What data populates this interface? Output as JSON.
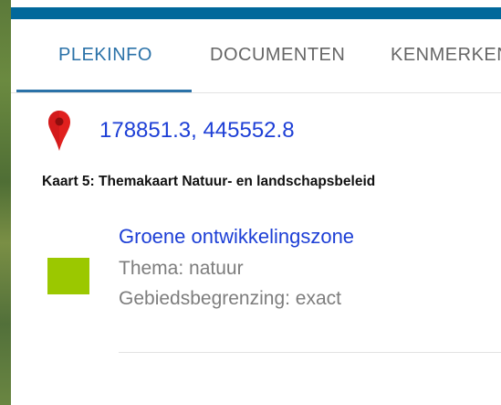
{
  "colors": {
    "top_bar": "#01689b",
    "active_tab": "#2b72a8",
    "link": "#1d3fd6",
    "pin": "#e0201e",
    "swatch": "#9bc800"
  },
  "tabs": [
    {
      "label": "PLEKINFO",
      "active": true
    },
    {
      "label": "DOCUMENTEN",
      "active": false
    },
    {
      "label": "KENMERKEN",
      "active": false
    }
  ],
  "location": {
    "icon": "map-pin-icon",
    "coordinates": "178851.3, 445552.8"
  },
  "kaart": {
    "title": "Kaart 5: Themakaart Natuur- en landschapsbeleid"
  },
  "feature": {
    "name": "Groene ontwikkelingszone",
    "thema": "Thema: natuur",
    "gebiedsbegrenzing": "Gebiedsbegrenzing: exact"
  }
}
